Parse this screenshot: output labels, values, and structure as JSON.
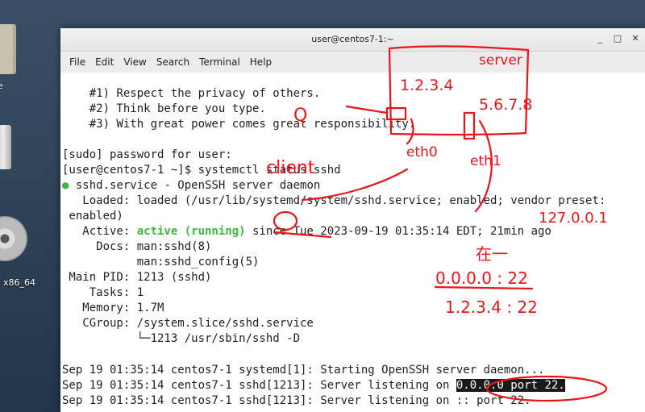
{
  "desktop": {
    "icons": [
      {
        "name": "folder-icon",
        "label": ""
      },
      {
        "name": "trash-icon",
        "label": ""
      },
      {
        "name": "disc-icon",
        "label": "x86_64"
      }
    ],
    "edge_label": "e"
  },
  "window": {
    "title": "user@centos7-1:~",
    "controls": {
      "minimize": "_",
      "maximize": "□",
      "close": "✕"
    },
    "menu": [
      "File",
      "Edit",
      "View",
      "Search",
      "Terminal",
      "Help"
    ]
  },
  "terminal": {
    "lines": [
      "    #1) Respect the privacy of others.",
      "    #2) Think before you type.",
      "    #3) With great power comes great responsibility.",
      "",
      "[sudo] password for user:",
      "[user@centos7-1 ~]$ systemctl status sshd",
      " sshd.service - OpenSSH server daemon",
      "   Loaded: loaded (/usr/lib/systemd/system/sshd.service; enabled; vendor preset:",
      " enabled)",
      "   Active: ",
      "     Docs: man:sshd(8)",
      "           man:sshd_config(5)",
      " Main PID: 1213 (sshd)",
      "    Tasks: 1",
      "   Memory: 1.7M",
      "   CGroup: /system.slice/sshd.service",
      "           └─1213 /usr/sbin/sshd -D",
      "",
      "Sep 19 01:35:14 centos7-1 systemd[1]: Starting OpenSSH server daemon...",
      "Sep 19 01:35:14 centos7-1 sshd[1213]: Server listening on ",
      "Sep 19 01:35:14 centos7-1 sshd[1213]: Server listening on :: port 22."
    ],
    "status_dot": "●",
    "active_state": "active (running)",
    "active_since": " since Tue 2023-09-19 01:35:14 EDT; 21min ago",
    "listen_highlight": "0.0.0.0 port 22."
  },
  "annotations": {
    "server": "server",
    "ip1": "1.2.3.4",
    "ip2": "5.6.7.8",
    "eth0": "eth0",
    "eth1": "eth1",
    "q": "Q",
    "client": "client",
    "loopback": "127.0.0.1",
    "zai": "在一",
    "bind_all": "0.0.0.0 : 22",
    "bind_ip": "1.2.3.4 : 22",
    "accent": "#e8151b"
  }
}
